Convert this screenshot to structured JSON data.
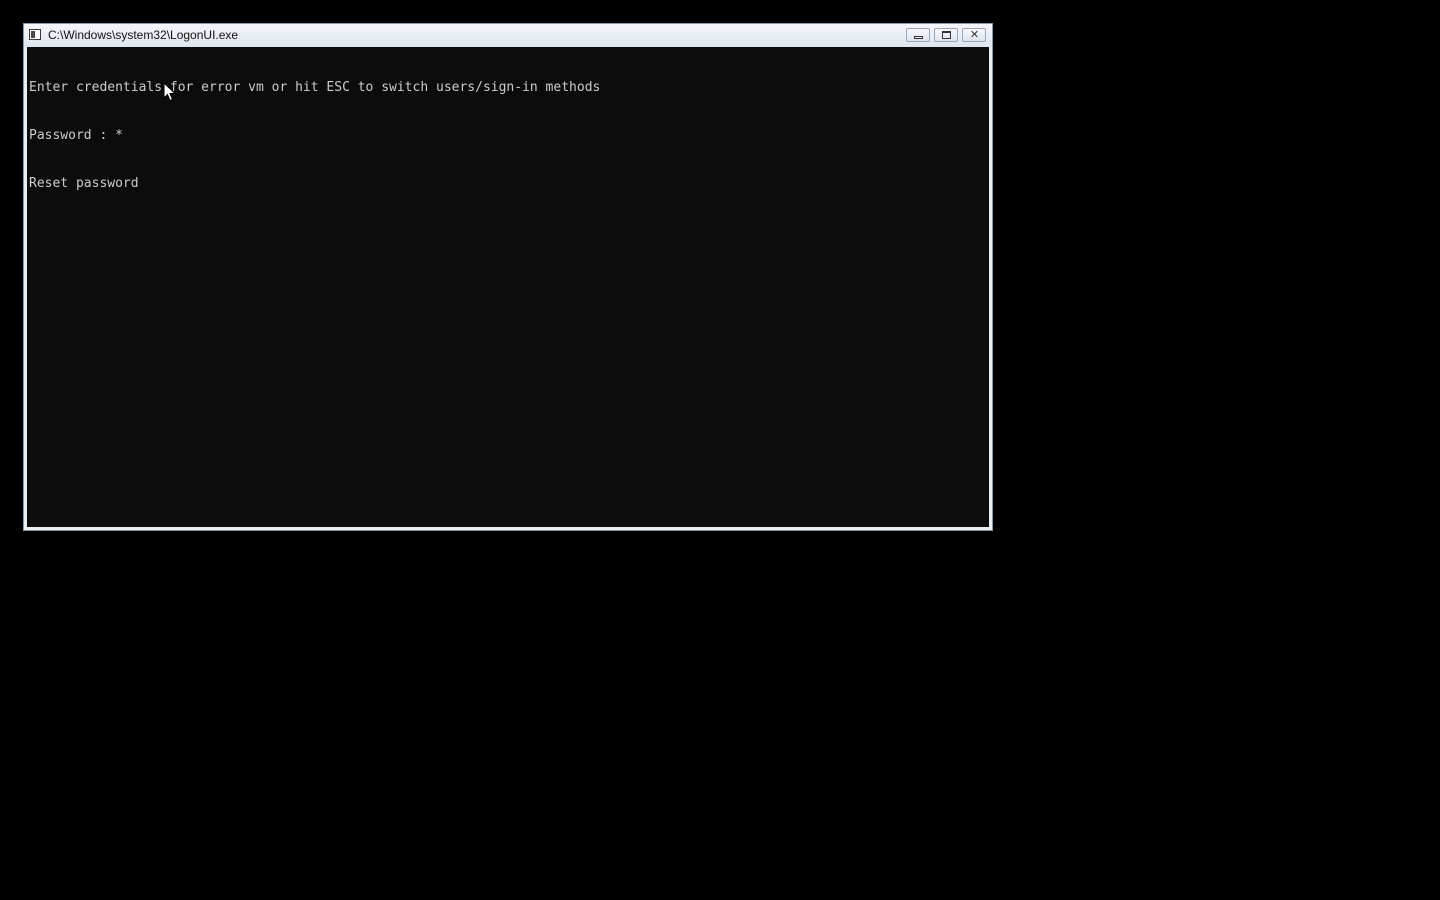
{
  "window": {
    "title": "C:\\Windows\\system32\\LogonUI.exe",
    "controls": {
      "minimize": "minimize-icon",
      "maximize": "maximize-icon",
      "close": "close-icon"
    }
  },
  "console": {
    "lines": [
      "Enter credentials for error vm or hit ESC to switch users/sign-in methods",
      "Password : *",
      "Reset password"
    ]
  },
  "colors": {
    "desktop_bg": "#000000",
    "console_bg": "#0c0c0c",
    "console_text": "#cccccc",
    "titlebar": "#dfe6ef"
  }
}
